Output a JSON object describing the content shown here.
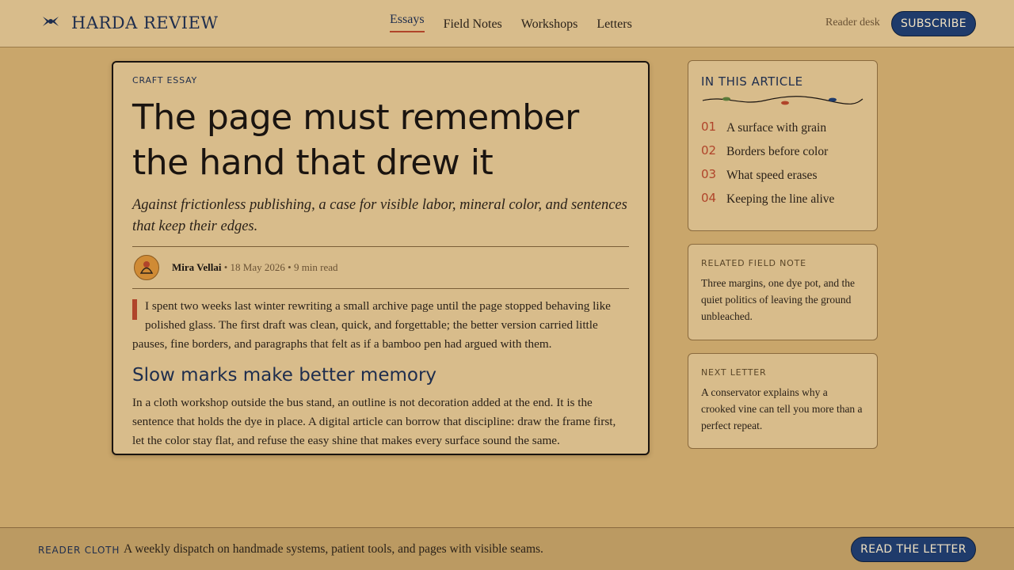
{
  "header": {
    "brand": "HARDA REVIEW",
    "brand_icon": "bird-emblem-icon",
    "nav": [
      {
        "label": "Essays",
        "active": true
      },
      {
        "label": "Field Notes",
        "active": false
      },
      {
        "label": "Workshops",
        "active": false
      },
      {
        "label": "Letters",
        "active": false
      }
    ],
    "reader_desk": "Reader desk",
    "subscribe": "SUBSCRIBE"
  },
  "article": {
    "kicker": "CRAFT ESSAY",
    "headline": "The page must remember the hand that drew it",
    "dek": "Against frictionless publishing, a case for visible labor, mineral color, and sentences that keep their edges.",
    "author": "Mira Vellai",
    "date": "18 May 2026",
    "read_time": "9 min read",
    "separator": "•",
    "avatar_icon": "artisan-avatar-icon",
    "lead_paragraph": "I spent two weeks last winter rewriting a small archive page until the page stopped behaving like polished glass. The first draft was clean, quick, and forgettable; the better version carried little pauses, fine borders, and paragraphs that felt as if a bamboo pen had argued with them.",
    "subhead": "Slow marks make better memory",
    "paragraph_2": "In a cloth workshop outside the bus stand, an outline is not decoration added at the end. It is the sentence that holds the dye in place. A digital article can borrow that discipline: draw the frame first, let the color stay flat, and refuse the easy shine that makes every surface sound the same."
  },
  "toc": {
    "title": "IN THIS ARTICLE",
    "divider_icon": "vine-divider-icon",
    "items": [
      {
        "num": "01",
        "label": "A surface with grain"
      },
      {
        "num": "02",
        "label": "Borders before color"
      },
      {
        "num": "03",
        "label": "What speed erases"
      },
      {
        "num": "04",
        "label": "Keeping the line alive"
      }
    ]
  },
  "related": {
    "kicker": "RELATED FIELD NOTE",
    "text": "Three margins, one dye pot, and the quiet politics of leaving the ground unbleached."
  },
  "next_letter": {
    "kicker": "NEXT LETTER",
    "text": "A conservator explains why a crooked vine can tell you more than a perfect repeat."
  },
  "footer": {
    "kicker": "READER CLOTH",
    "text": "A weekly dispatch on handmade systems, patient tools, and pages with visible seams.",
    "button": "READ THE LETTER"
  },
  "colors": {
    "background": "#c9a66b",
    "card": "#d8bc8b",
    "ink": "#1a1410",
    "navy": "#1e2d4d",
    "button": "#1f3b6b",
    "accent_red": "#b0442a",
    "avatar": "#d08b35"
  }
}
